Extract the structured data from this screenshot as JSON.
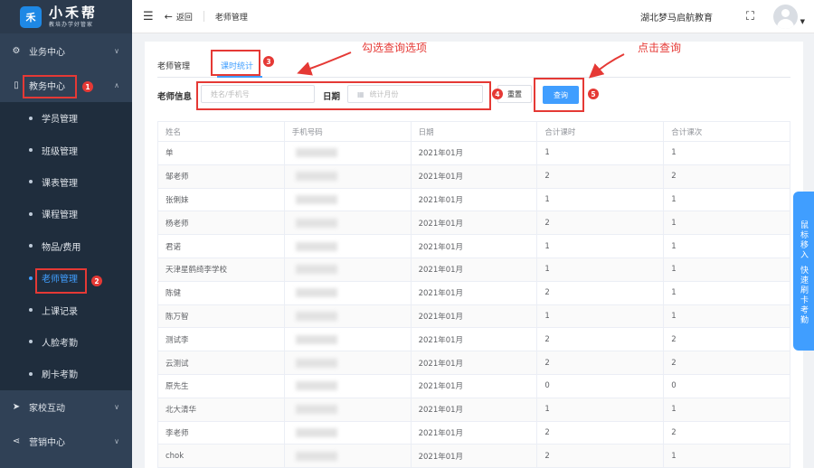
{
  "logo": {
    "mark": "禾",
    "name": "小禾帮",
    "slogan": "教培办学好管家"
  },
  "sidebar": {
    "groups": [
      {
        "label": "业务中心",
        "icon": "gear-icon"
      },
      {
        "label": "教务中心",
        "icon": "book-icon"
      },
      {
        "label": "家校互动",
        "icon": "send-icon"
      },
      {
        "label": "营销中心",
        "icon": "share-icon"
      }
    ],
    "jiaowu_items": [
      "学员管理",
      "班级管理",
      "课表管理",
      "课程管理",
      "物品/费用",
      "老师管理",
      "上课记录",
      "人脸考勤",
      "刷卡考勤"
    ],
    "active_item": "老师管理"
  },
  "header": {
    "back_label": "返回",
    "breadcrumb": "老师管理",
    "org_name": "湖北梦马启航教育"
  },
  "tabs": {
    "tab1": "老师管理",
    "tab2": "课时统计"
  },
  "filters": {
    "teacher_label": "老师信息",
    "teacher_placeholder": "姓名/手机号",
    "date_label": "日期",
    "date_placeholder": "统计月份",
    "reset_label": "重置",
    "query_label": "查询"
  },
  "table": {
    "columns": [
      "姓名",
      "手机号码",
      "日期",
      "合计课时",
      "合计课次"
    ],
    "rows": [
      {
        "name": "单",
        "date": "2021年01月",
        "hours": "1",
        "times": "1"
      },
      {
        "name": "邹老师",
        "date": "2021年01月",
        "hours": "2",
        "times": "2"
      },
      {
        "name": "张俐妹",
        "date": "2021年01月",
        "hours": "1",
        "times": "1"
      },
      {
        "name": "杨老师",
        "date": "2021年01月",
        "hours": "2",
        "times": "1"
      },
      {
        "name": "君诺",
        "date": "2021年01月",
        "hours": "1",
        "times": "1"
      },
      {
        "name": "天津星鹤绮李学校",
        "date": "2021年01月",
        "hours": "1",
        "times": "1"
      },
      {
        "name": "陈健",
        "date": "2021年01月",
        "hours": "2",
        "times": "1"
      },
      {
        "name": "陈万智",
        "date": "2021年01月",
        "hours": "1",
        "times": "1"
      },
      {
        "name": "测试李",
        "date": "2021年01月",
        "hours": "2",
        "times": "2"
      },
      {
        "name": "云测试",
        "date": "2021年01月",
        "hours": "2",
        "times": "2"
      },
      {
        "name": "原先生",
        "date": "2021年01月",
        "hours": "0",
        "times": "0"
      },
      {
        "name": "北大清华",
        "date": "2021年01月",
        "hours": "1",
        "times": "1"
      },
      {
        "name": "李老师",
        "date": "2021年01月",
        "hours": "2",
        "times": "2"
      },
      {
        "name": "chok",
        "date": "2021年01月",
        "hours": "2",
        "times": "1"
      }
    ]
  },
  "float_tab": {
    "line1": "鼠标移入",
    "line2": "快速刷卡考勤"
  },
  "annotations": {
    "note_tab": "勾选查询选项",
    "note_query": "点击查询",
    "b1": "1",
    "b2": "2",
    "b3": "3",
    "b4": "4",
    "b5": "5"
  },
  "colors": {
    "sidebar": "#304156",
    "accent": "#409eff",
    "annotation": "#e53935"
  }
}
